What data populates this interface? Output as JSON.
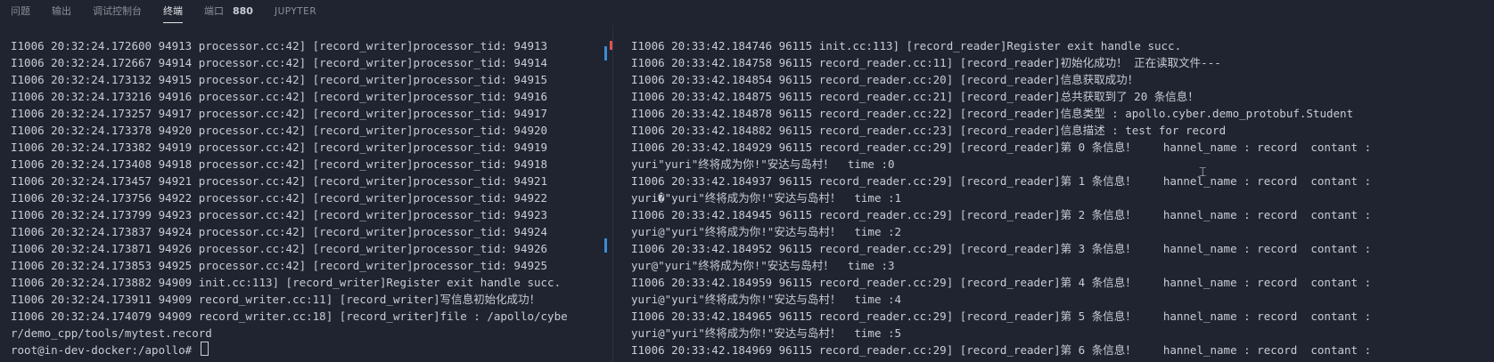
{
  "tabs": [
    {
      "label": "问题",
      "active": false
    },
    {
      "label": "输出",
      "active": false
    },
    {
      "label": "调试控制台",
      "active": false
    },
    {
      "label": "终端",
      "active": true
    },
    {
      "label": "端口",
      "badge": "880",
      "active": false
    },
    {
      "label": "JUPYTER",
      "active": false
    }
  ],
  "left_terminal": {
    "lines": [
      "I1006 20:32:24.172600 94913 processor.cc:42] [record_writer]processor_tid: 94913",
      "I1006 20:32:24.172667 94914 processor.cc:42] [record_writer]processor_tid: 94914",
      "I1006 20:32:24.173132 94915 processor.cc:42] [record_writer]processor_tid: 94915",
      "I1006 20:32:24.173216 94916 processor.cc:42] [record_writer]processor_tid: 94916",
      "I1006 20:32:24.173257 94917 processor.cc:42] [record_writer]processor_tid: 94917",
      "I1006 20:32:24.173378 94920 processor.cc:42] [record_writer]processor_tid: 94920",
      "I1006 20:32:24.173382 94919 processor.cc:42] [record_writer]processor_tid: 94919",
      "I1006 20:32:24.173408 94918 processor.cc:42] [record_writer]processor_tid: 94918",
      "I1006 20:32:24.173457 94921 processor.cc:42] [record_writer]processor_tid: 94921",
      "I1006 20:32:24.173756 94922 processor.cc:42] [record_writer]processor_tid: 94922",
      "I1006 20:32:24.173799 94923 processor.cc:42] [record_writer]processor_tid: 94923",
      "I1006 20:32:24.173837 94924 processor.cc:42] [record_writer]processor_tid: 94924",
      "I1006 20:32:24.173871 94926 processor.cc:42] [record_writer]processor_tid: 94926",
      "I1006 20:32:24.173853 94925 processor.cc:42] [record_writer]processor_tid: 94925",
      "I1006 20:32:24.173882 94909 init.cc:113] [record_writer]Register exit handle succ.",
      "I1006 20:32:24.173911 94909 record_writer.cc:11] [record_writer]写信息初始化成功！",
      "I1006 20:32:24.174079 94909 record_writer.cc:18] [record_writer]file : /apollo/cybe",
      "r/demo_cpp/tools/mytest.record"
    ],
    "prompt": "root@in-dev-docker:/apollo#"
  },
  "right_terminal": {
    "lines": [
      "I1006 20:33:42.184746 96115 init.cc:113] [record_reader]Register exit handle succ.",
      "I1006 20:33:42.184758 96115 record_reader.cc:11] [record_reader]初始化成功！ 正在读取文件---",
      "I1006 20:33:42.184854 96115 record_reader.cc:20] [record_reader]信息获取成功！",
      "I1006 20:33:42.184875 96115 record_reader.cc:21] [record_reader]总共获取到了 20 条信息！",
      "I1006 20:33:42.184878 96115 record_reader.cc:22] [record_reader]信息类型 : apollo.cyber.demo_protobuf.Student",
      "I1006 20:33:42.184882 96115 record_reader.cc:23] [record_reader]信息描述 : test for record",
      "I1006 20:33:42.184929 96115 record_reader.cc:29] [record_reader]第 0 条信息！    hannel_name : record  contant :",
      "yuri\"yuri\"终将成为你!\"安达与岛村！  time :0",
      "I1006 20:33:42.184937 96115 record_reader.cc:29] [record_reader]第 1 条信息！    hannel_name : record  contant :",
      "yuri�\"yuri\"终将成为你!\"安达与岛村！  time :1",
      "I1006 20:33:42.184945 96115 record_reader.cc:29] [record_reader]第 2 条信息！    hannel_name : record  contant :",
      "yuri@\"yuri\"终将成为你!\"安达与岛村！  time :2",
      "I1006 20:33:42.184952 96115 record_reader.cc:29] [record_reader]第 3 条信息！    hannel_name : record  contant :",
      "yur@\"yuri\"终将成为你!\"安达与岛村！  time :3",
      "I1006 20:33:42.184959 96115 record_reader.cc:29] [record_reader]第 4 条信息！    hannel_name : record  contant :",
      "yuri@\"yuri\"终将成为你!\"安达与岛村！  time :4",
      "I1006 20:33:42.184965 96115 record_reader.cc:29] [record_reader]第 5 条信息！    hannel_name : record  contant :",
      "yuri@\"yuri\"终将成为你!\"安达与岛村！  time :5",
      "I1006 20:33:42.184969 96115 record_reader.cc:29] [record_reader]第 6 条信息！    hannel_name : record  contant :"
    ]
  }
}
